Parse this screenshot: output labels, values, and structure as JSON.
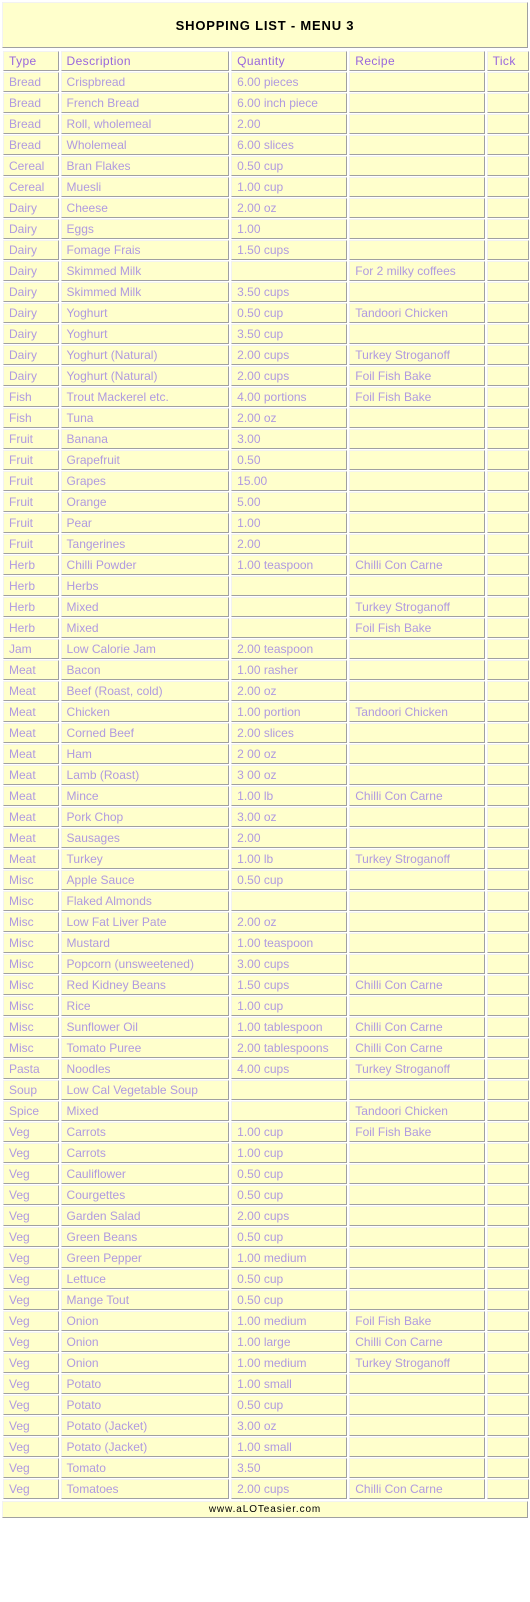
{
  "page": {
    "title": "SHOPPING LIST - MENU 3",
    "footer": "www.aLOTeasier.com",
    "colors": {
      "cell_background": "#ffffcc",
      "header_text": "#9966dd",
      "body_text": "#b09ae0",
      "title_text": "#000000",
      "page_background": "#ffffff",
      "cell_border_light": "#f2f2f2",
      "cell_border_dark": "#a0a0a0"
    }
  },
  "table": {
    "columns": [
      "Type",
      "Description",
      "Quantity",
      "Recipe",
      "Tick"
    ],
    "rows": [
      {
        "type": "Bread",
        "description": "Crispbread",
        "quantity": "6.00 pieces",
        "recipe": "",
        "tick": ""
      },
      {
        "type": "Bread",
        "description": "French Bread",
        "quantity": "6.00 inch piece",
        "recipe": "",
        "tick": ""
      },
      {
        "type": "Bread",
        "description": "Roll, wholemeal",
        "quantity": "2.00",
        "recipe": "",
        "tick": ""
      },
      {
        "type": "Bread",
        "description": "Wholemeal",
        "quantity": "6.00 slices",
        "recipe": "",
        "tick": ""
      },
      {
        "type": "Cereal",
        "description": "Bran Flakes",
        "quantity": "0.50 cup",
        "recipe": "",
        "tick": ""
      },
      {
        "type": "Cereal",
        "description": "Muesli",
        "quantity": "1.00 cup",
        "recipe": "",
        "tick": ""
      },
      {
        "type": "Dairy",
        "description": "Cheese",
        "quantity": "2.00 oz",
        "recipe": "",
        "tick": ""
      },
      {
        "type": "Dairy",
        "description": "Eggs",
        "quantity": "1.00",
        "recipe": "",
        "tick": ""
      },
      {
        "type": "Dairy",
        "description": "Fomage Frais",
        "quantity": "1.50 cups",
        "recipe": "",
        "tick": ""
      },
      {
        "type": "Dairy",
        "description": "Skimmed Milk",
        "quantity": "",
        "recipe": "For 2 milky coffees",
        "tick": ""
      },
      {
        "type": "Dairy",
        "description": "Skimmed Milk",
        "quantity": "3.50 cups",
        "recipe": "",
        "tick": ""
      },
      {
        "type": "Dairy",
        "description": "Yoghurt",
        "quantity": "0.50 cup",
        "recipe": "Tandoori Chicken",
        "tick": ""
      },
      {
        "type": "Dairy",
        "description": "Yoghurt",
        "quantity": "3.50 cup",
        "recipe": "",
        "tick": ""
      },
      {
        "type": "Dairy",
        "description": "Yoghurt (Natural)",
        "quantity": "2.00 cups",
        "recipe": "Turkey Stroganoff",
        "tick": ""
      },
      {
        "type": "Dairy",
        "description": "Yoghurt (Natural)",
        "quantity": "2.00 cups",
        "recipe": "Foil Fish Bake",
        "tick": ""
      },
      {
        "type": "Fish",
        "description": "Trout Mackerel etc.",
        "quantity": "4.00 portions",
        "recipe": "Foil Fish Bake",
        "tick": ""
      },
      {
        "type": "Fish",
        "description": "Tuna",
        "quantity": "2.00 oz",
        "recipe": "",
        "tick": ""
      },
      {
        "type": "Fruit",
        "description": "Banana",
        "quantity": "3.00",
        "recipe": "",
        "tick": ""
      },
      {
        "type": "Fruit",
        "description": "Grapefruit",
        "quantity": "0.50",
        "recipe": "",
        "tick": ""
      },
      {
        "type": "Fruit",
        "description": "Grapes",
        "quantity": "15.00",
        "recipe": "",
        "tick": ""
      },
      {
        "type": "Fruit",
        "description": "Orange",
        "quantity": "5.00",
        "recipe": "",
        "tick": ""
      },
      {
        "type": "Fruit",
        "description": "Pear",
        "quantity": "1.00",
        "recipe": "",
        "tick": ""
      },
      {
        "type": "Fruit",
        "description": "Tangerines",
        "quantity": "2.00",
        "recipe": "",
        "tick": ""
      },
      {
        "type": "Herb",
        "description": "Chilli Powder",
        "quantity": "1.00 teaspoon",
        "recipe": "Chilli Con Carne",
        "tick": ""
      },
      {
        "type": "Herb",
        "description": "Herbs",
        "quantity": "",
        "recipe": "",
        "tick": ""
      },
      {
        "type": "Herb",
        "description": "Mixed",
        "quantity": "",
        "recipe": "Turkey Stroganoff",
        "tick": ""
      },
      {
        "type": "Herb",
        "description": "Mixed",
        "quantity": "",
        "recipe": "Foil Fish Bake",
        "tick": ""
      },
      {
        "type": "Jam",
        "description": "Low Calorie Jam",
        "quantity": "2.00 teaspoon",
        "recipe": "",
        "tick": ""
      },
      {
        "type": "Meat",
        "description": "Bacon",
        "quantity": "1.00 rasher",
        "recipe": "",
        "tick": ""
      },
      {
        "type": "Meat",
        "description": "Beef (Roast, cold)",
        "quantity": "2.00 oz",
        "recipe": "",
        "tick": ""
      },
      {
        "type": "Meat",
        "description": "Chicken",
        "quantity": "1.00 portion",
        "recipe": "Tandoori Chicken",
        "tick": ""
      },
      {
        "type": "Meat",
        "description": "Corned Beef",
        "quantity": "2.00 slices",
        "recipe": "",
        "tick": ""
      },
      {
        "type": "Meat",
        "description": "Ham",
        "quantity": "2 00 oz",
        "recipe": "",
        "tick": ""
      },
      {
        "type": "Meat",
        "description": "Lamb (Roast)",
        "quantity": "3 00 oz",
        "recipe": "",
        "tick": ""
      },
      {
        "type": "Meat",
        "description": "Mince",
        "quantity": "1.00 lb",
        "recipe": "Chilli Con Carne",
        "tick": ""
      },
      {
        "type": "Meat",
        "description": "Pork Chop",
        "quantity": "3.00 oz",
        "recipe": "",
        "tick": ""
      },
      {
        "type": "Meat",
        "description": "Sausages",
        "quantity": "2.00",
        "recipe": "",
        "tick": ""
      },
      {
        "type": "Meat",
        "description": "Turkey",
        "quantity": "1.00 lb",
        "recipe": "Turkey Stroganoff",
        "tick": ""
      },
      {
        "type": "Misc",
        "description": "Apple Sauce",
        "quantity": "0.50 cup",
        "recipe": "",
        "tick": ""
      },
      {
        "type": "Misc",
        "description": "Flaked Almonds",
        "quantity": "",
        "recipe": "",
        "tick": ""
      },
      {
        "type": "Misc",
        "description": "Low Fat Liver Pate",
        "quantity": "2.00 oz",
        "recipe": "",
        "tick": ""
      },
      {
        "type": "Misc",
        "description": "Mustard",
        "quantity": "1.00 teaspoon",
        "recipe": "",
        "tick": ""
      },
      {
        "type": "Misc",
        "description": "Popcorn (unsweetened)",
        "quantity": "3.00 cups",
        "recipe": "",
        "tick": ""
      },
      {
        "type": "Misc",
        "description": "Red Kidney Beans",
        "quantity": "1.50 cups",
        "recipe": "Chilli Con Carne",
        "tick": ""
      },
      {
        "type": "Misc",
        "description": "Rice",
        "quantity": "1.00 cup",
        "recipe": "",
        "tick": ""
      },
      {
        "type": "Misc",
        "description": "Sunflower Oil",
        "quantity": "1.00 tablespoon",
        "recipe": "Chilli Con Carne",
        "tick": ""
      },
      {
        "type": "Misc",
        "description": "Tomato Puree",
        "quantity": "2.00 tablespoons",
        "recipe": "Chilli Con Carne",
        "tick": ""
      },
      {
        "type": "Pasta",
        "description": "Noodles",
        "quantity": "4.00 cups",
        "recipe": "Turkey Stroganoff",
        "tick": ""
      },
      {
        "type": "Soup",
        "description": "Low Cal Vegetable Soup",
        "quantity": "",
        "recipe": "",
        "tick": ""
      },
      {
        "type": "Spice",
        "description": "Mixed",
        "quantity": "",
        "recipe": "Tandoori Chicken",
        "tick": ""
      },
      {
        "type": "Veg",
        "description": "Carrots",
        "quantity": "1.00 cup",
        "recipe": "Foil Fish Bake",
        "tick": ""
      },
      {
        "type": "Veg",
        "description": "Carrots",
        "quantity": "1.00 cup",
        "recipe": "",
        "tick": ""
      },
      {
        "type": "Veg",
        "description": "Cauliflower",
        "quantity": "0.50 cup",
        "recipe": "",
        "tick": ""
      },
      {
        "type": "Veg",
        "description": "Courgettes",
        "quantity": "0.50 cup",
        "recipe": "",
        "tick": ""
      },
      {
        "type": "Veg",
        "description": "Garden Salad",
        "quantity": "2.00 cups",
        "recipe": "",
        "tick": ""
      },
      {
        "type": "Veg",
        "description": "Green Beans",
        "quantity": "0.50 cup",
        "recipe": "",
        "tick": ""
      },
      {
        "type": "Veg",
        "description": "Green Pepper",
        "quantity": "1.00 medium",
        "recipe": "",
        "tick": ""
      },
      {
        "type": "Veg",
        "description": "Lettuce",
        "quantity": "0.50 cup",
        "recipe": "",
        "tick": ""
      },
      {
        "type": "Veg",
        "description": "Mange Tout",
        "quantity": "0.50 cup",
        "recipe": "",
        "tick": ""
      },
      {
        "type": "Veg",
        "description": "Onion",
        "quantity": "1.00 medium",
        "recipe": "Foil Fish Bake",
        "tick": ""
      },
      {
        "type": "Veg",
        "description": "Onion",
        "quantity": "1.00 large",
        "recipe": "Chilli Con Carne",
        "tick": ""
      },
      {
        "type": "Veg",
        "description": "Onion",
        "quantity": "1.00 medium",
        "recipe": "Turkey Stroganoff",
        "tick": ""
      },
      {
        "type": "Veg",
        "description": "Potato",
        "quantity": "1.00 small",
        "recipe": "",
        "tick": ""
      },
      {
        "type": "Veg",
        "description": "Potato",
        "quantity": "0.50 cup",
        "recipe": "",
        "tick": ""
      },
      {
        "type": "Veg",
        "description": "Potato (Jacket)",
        "quantity": "3.00 oz",
        "recipe": "",
        "tick": ""
      },
      {
        "type": "Veg",
        "description": "Potato (Jacket)",
        "quantity": "1.00 small",
        "recipe": "",
        "tick": ""
      },
      {
        "type": "Veg",
        "description": "Tomato",
        "quantity": "3.50",
        "recipe": "",
        "tick": ""
      },
      {
        "type": "Veg",
        "description": "Tomatoes",
        "quantity": "2.00 cups",
        "recipe": "Chilli Con Carne",
        "tick": ""
      }
    ]
  }
}
